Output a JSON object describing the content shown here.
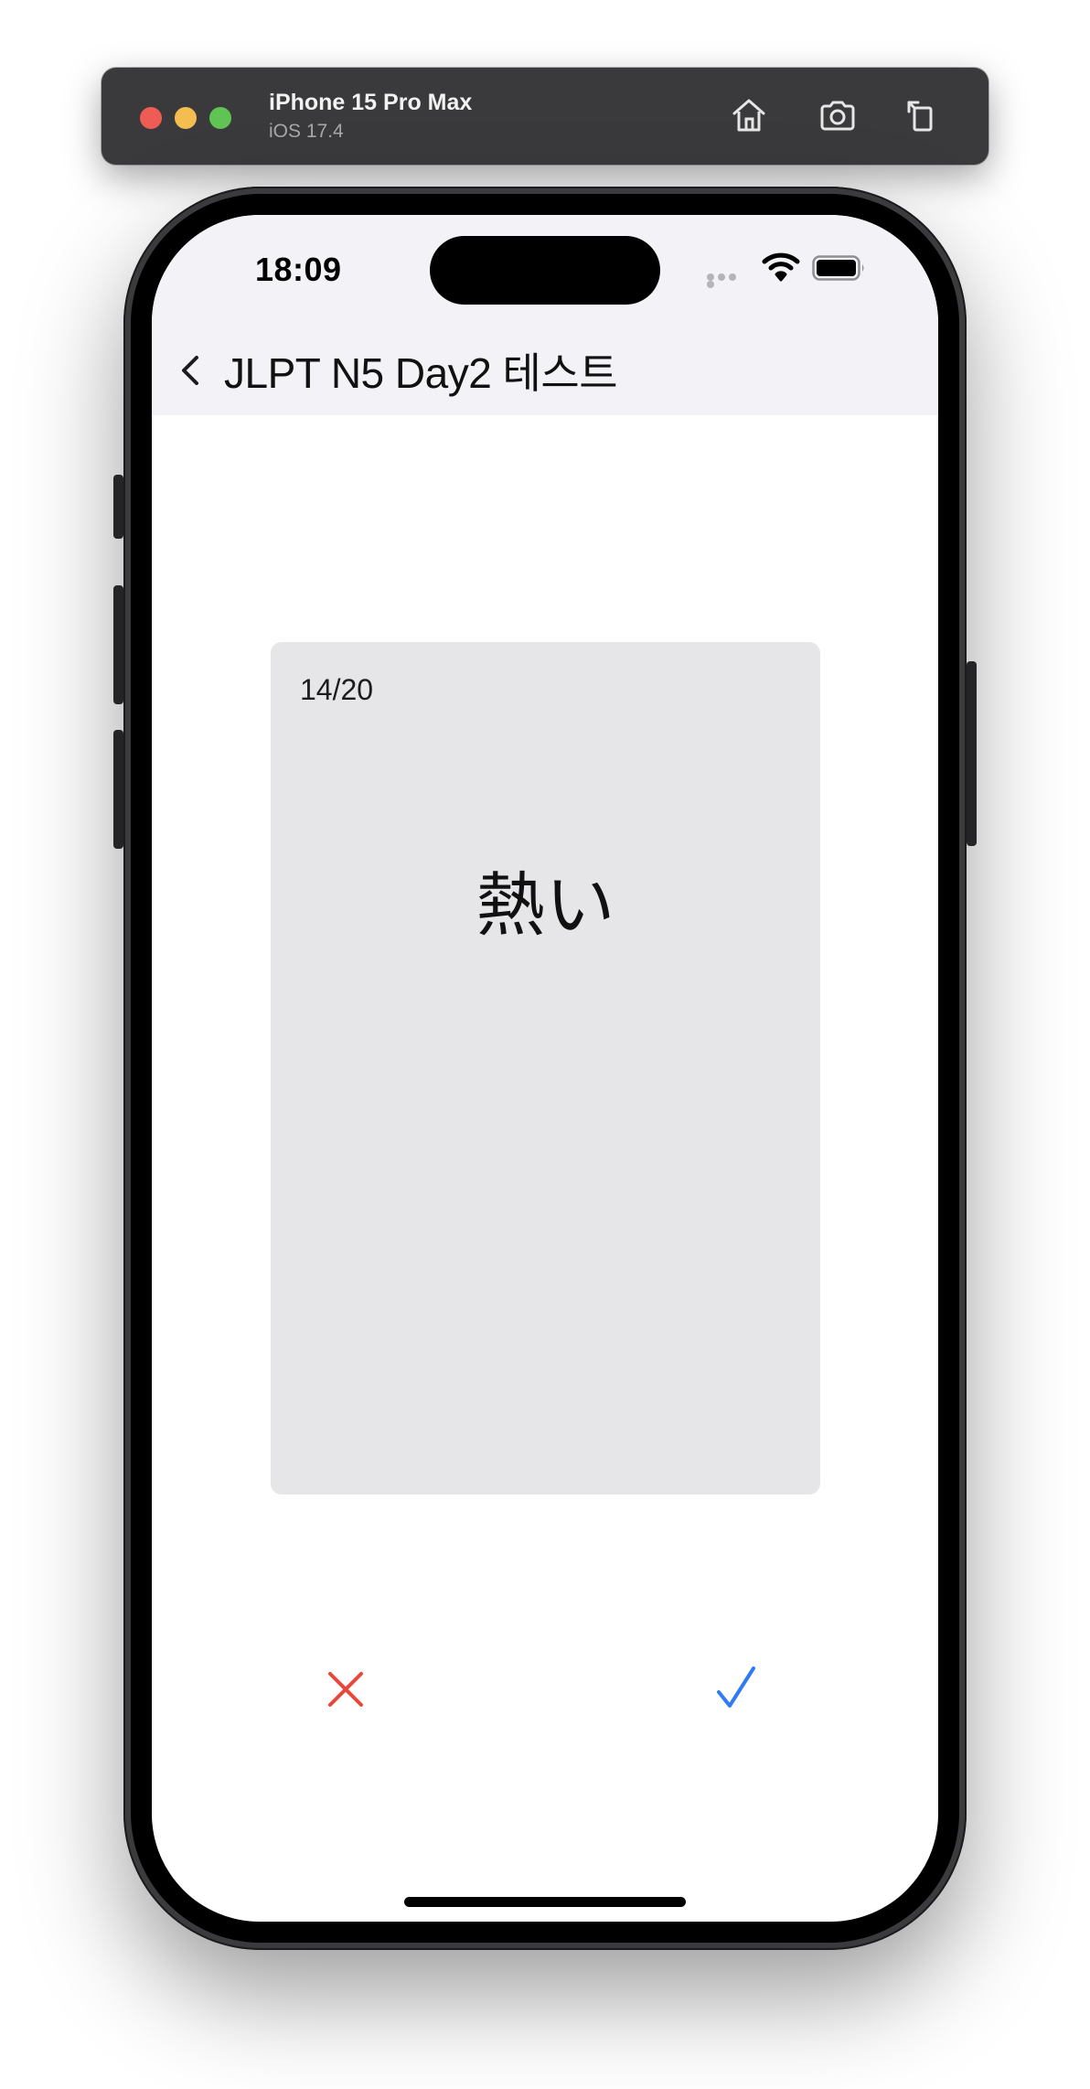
{
  "simulator": {
    "device_name": "iPhone 15 Pro Max",
    "os_version": "iOS 17.4",
    "toolbar_icons": [
      "home-icon",
      "screenshot-icon",
      "rotate-icon"
    ]
  },
  "status_bar": {
    "time": "18:09",
    "icons": [
      "cellular-signal-icon",
      "wifi-icon",
      "battery-icon"
    ]
  },
  "navigation": {
    "back_icon": "chevron-left-icon",
    "title": "JLPT N5 Day2 테스트"
  },
  "card": {
    "progress": "14/20",
    "word": "熱い"
  },
  "answers": {
    "wrong_icon": "x-mark-icon",
    "right_icon": "checkmark-icon"
  },
  "colors": {
    "wrong": "#e8483b",
    "right": "#2f7bf6",
    "card_background": "#e6e6e9",
    "nav_background": "#f2f2f7"
  }
}
